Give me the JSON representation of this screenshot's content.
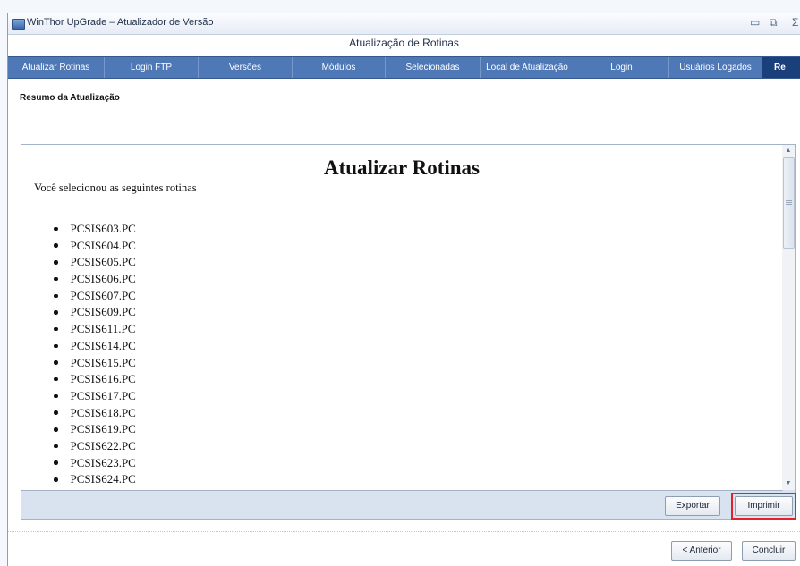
{
  "window": {
    "title": "WinThor UpGrade – Atualizador de Versão",
    "app_icon": "winthor-app-icon",
    "controls": {
      "minimize": "▭",
      "restore": "⧉",
      "close": "Σ"
    }
  },
  "header": {
    "title": "Atualização de Rotinas"
  },
  "tabs": [
    {
      "label": "Atualizar Rotinas"
    },
    {
      "label": "Login FTP"
    },
    {
      "label": "Versões"
    },
    {
      "label": "Módulos"
    },
    {
      "label": "Selecionadas"
    },
    {
      "label": "Local de Atualização"
    },
    {
      "label": "Login"
    },
    {
      "label": "Usuários Logados"
    },
    {
      "label": "Re",
      "active": true
    }
  ],
  "section": {
    "label": "Resumo da Atualização"
  },
  "report": {
    "title": "Atualizar Rotinas",
    "subtitle": "Você selecionou as seguintes rotinas",
    "routines": [
      "PCSIS603.PC",
      "PCSIS604.PC",
      "PCSIS605.PC",
      "PCSIS606.PC",
      "PCSIS607.PC",
      "PCSIS609.PC",
      "PCSIS611.PC",
      "PCSIS614.PC",
      "PCSIS615.PC",
      "PCSIS616.PC",
      "PCSIS617.PC",
      "PCSIS618.PC",
      "PCSIS619.PC",
      "PCSIS622.PC",
      "PCSIS623.PC",
      "PCSIS624.PC"
    ]
  },
  "report_actions": {
    "export_label": "Exportar",
    "print_label": "Imprimir"
  },
  "footer": {
    "previous_label": "< Anterior",
    "finish_label": "Concluir"
  },
  "colors": {
    "tab_bar": "#4e78b6",
    "active_tab": "#1b3f7a",
    "highlight": "#e02230"
  }
}
